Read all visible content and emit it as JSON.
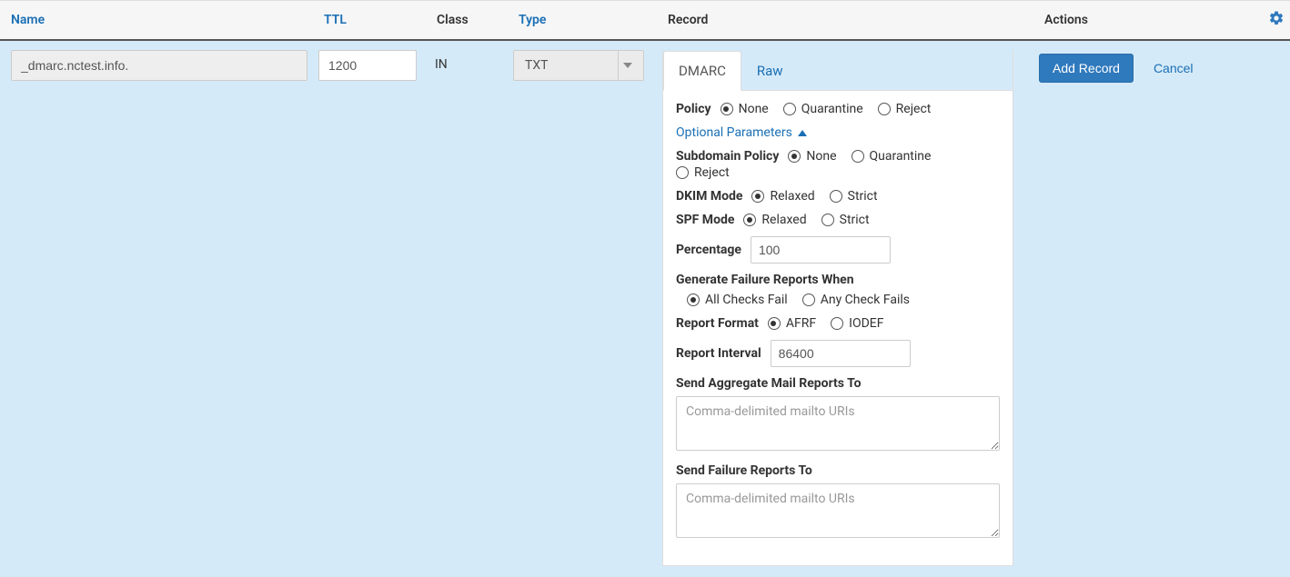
{
  "columns": {
    "name": "Name",
    "ttl": "TTL",
    "class": "Class",
    "type": "Type",
    "record": "Record",
    "actions": "Actions"
  },
  "row": {
    "name": "_dmarc.nctest.info.",
    "ttl": "1200",
    "class": "IN",
    "type": "TXT"
  },
  "tabs": {
    "dmarc": "DMARC",
    "raw": "Raw"
  },
  "form": {
    "policy_label": "Policy",
    "policy_options": {
      "none": "None",
      "quarantine": "Quarantine",
      "reject": "Reject"
    },
    "optional_link": "Optional Parameters",
    "subdomain_label": "Subdomain Policy",
    "subdomain_options": {
      "none": "None",
      "quarantine": "Quarantine",
      "reject": "Reject"
    },
    "dkim_label": "DKIM Mode",
    "dkim_options": {
      "relaxed": "Relaxed",
      "strict": "Strict"
    },
    "spf_label": "SPF Mode",
    "spf_options": {
      "relaxed": "Relaxed",
      "strict": "Strict"
    },
    "percentage_label": "Percentage",
    "percentage_value": "100",
    "failure_label": "Generate Failure Reports When",
    "failure_options": {
      "all": "All Checks Fail",
      "any": "Any Check Fails"
    },
    "format_label": "Report Format",
    "format_options": {
      "afrf": "AFRF",
      "iodef": "IODEF"
    },
    "interval_label": "Report Interval",
    "interval_value": "86400",
    "aggregate_label": "Send Aggregate Mail Reports To",
    "aggregate_placeholder": "Comma-delimited mailto URIs",
    "failure_reports_label": "Send Failure Reports To",
    "failure_reports_placeholder": "Comma-delimited mailto URIs"
  },
  "actions": {
    "add": "Add Record",
    "cancel": "Cancel"
  }
}
